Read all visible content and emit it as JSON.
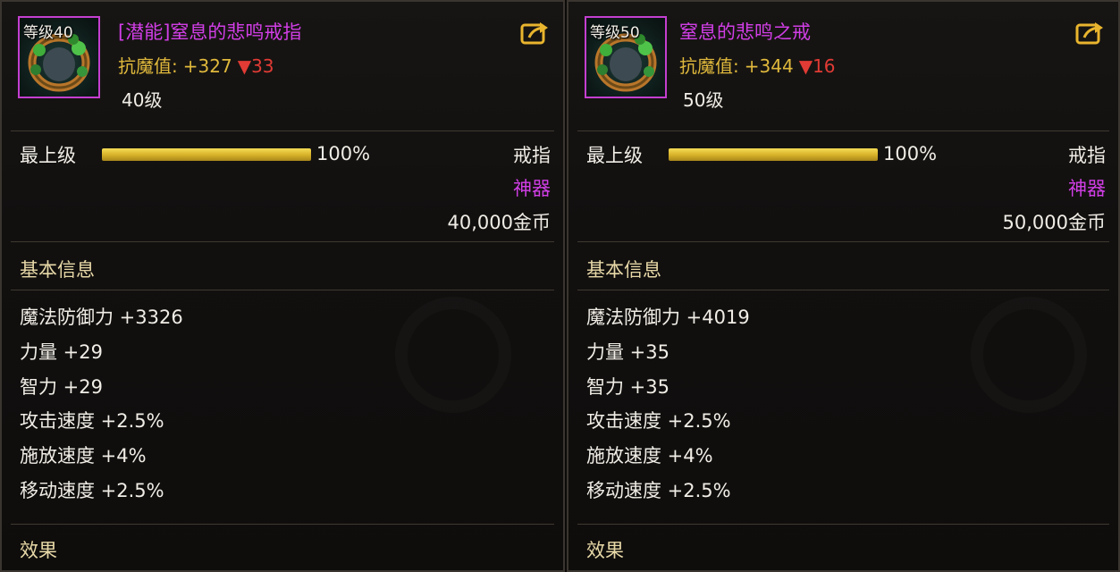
{
  "items": [
    {
      "level_badge": "等级40",
      "name": "[潜能]窒息的悲鸣戒指",
      "resist_label": "抗魔值:",
      "resist_value": "+327",
      "resist_change": "▼33",
      "required_level": "40级",
      "grade_label": "最上级",
      "grade_percent": "100%",
      "grade_fill": 1.0,
      "item_type": "戒指",
      "rarity": "神器",
      "price": "40,000金币",
      "basic_info_title": "基本信息",
      "stats": [
        "魔法防御力 +3326",
        "力量 +29",
        "智力 +29",
        "攻击速度 +2.5%",
        "施放速度 +4%",
        "移动速度 +2.5%"
      ],
      "effect_title": "效果"
    },
    {
      "level_badge": "等级50",
      "name": "窒息的悲鸣之戒",
      "resist_label": "抗魔值:",
      "resist_value": "+344",
      "resist_change": "▼16",
      "required_level": "50级",
      "grade_label": "最上级",
      "grade_percent": "100%",
      "grade_fill": 1.0,
      "item_type": "戒指",
      "rarity": "神器",
      "price": "50,000金币",
      "basic_info_title": "基本信息",
      "stats": [
        "魔法防御力 +4019",
        "力量 +35",
        "智力 +35",
        "攻击速度 +2.5%",
        "施放速度 +4%",
        "移动速度 +2.5%"
      ],
      "effect_title": "效果"
    }
  ],
  "colors": {
    "rarity_epic": "#d13ee6",
    "resist_gold": "#e0b93c",
    "decrease_red": "#e23b35",
    "grade_bar_gold": "#f5dc56"
  },
  "icons": [
    "ring-item-icon",
    "share-icon"
  ]
}
